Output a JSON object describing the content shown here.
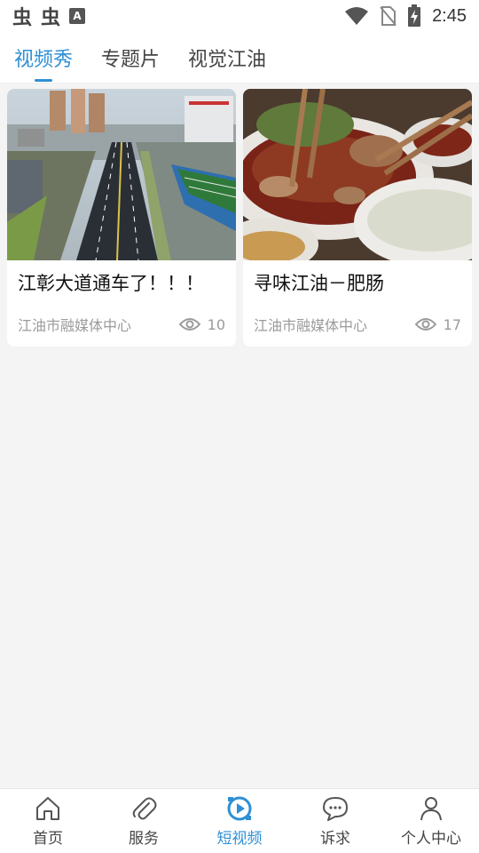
{
  "status_bar": {
    "left_glyphs": [
      "虫",
      "虫"
    ],
    "badge": "A",
    "time": "2:45"
  },
  "tabs": [
    {
      "label": "视频秀",
      "active": true
    },
    {
      "label": "专题片",
      "active": false
    },
    {
      "label": "视觉江油",
      "active": false
    }
  ],
  "cards": [
    {
      "title": "江彰大道通车了！！！",
      "source": "江油市融媒体中心",
      "views": "10"
    },
    {
      "title": "寻味江油－肥肠",
      "source": "江油市融媒体中心",
      "views": "17"
    }
  ],
  "bottom_nav": [
    {
      "label": "首页",
      "icon": "home-icon",
      "active": false
    },
    {
      "label": "服务",
      "icon": "paperclip-icon",
      "active": false
    },
    {
      "label": "短视频",
      "icon": "play-circle-icon",
      "active": true
    },
    {
      "label": "诉求",
      "icon": "chat-bubble-icon",
      "active": false
    },
    {
      "label": "个人中心",
      "icon": "person-icon",
      "active": false
    }
  ],
  "colors": {
    "accent": "#2f8fd4",
    "meta_text": "#9a9a9a"
  }
}
